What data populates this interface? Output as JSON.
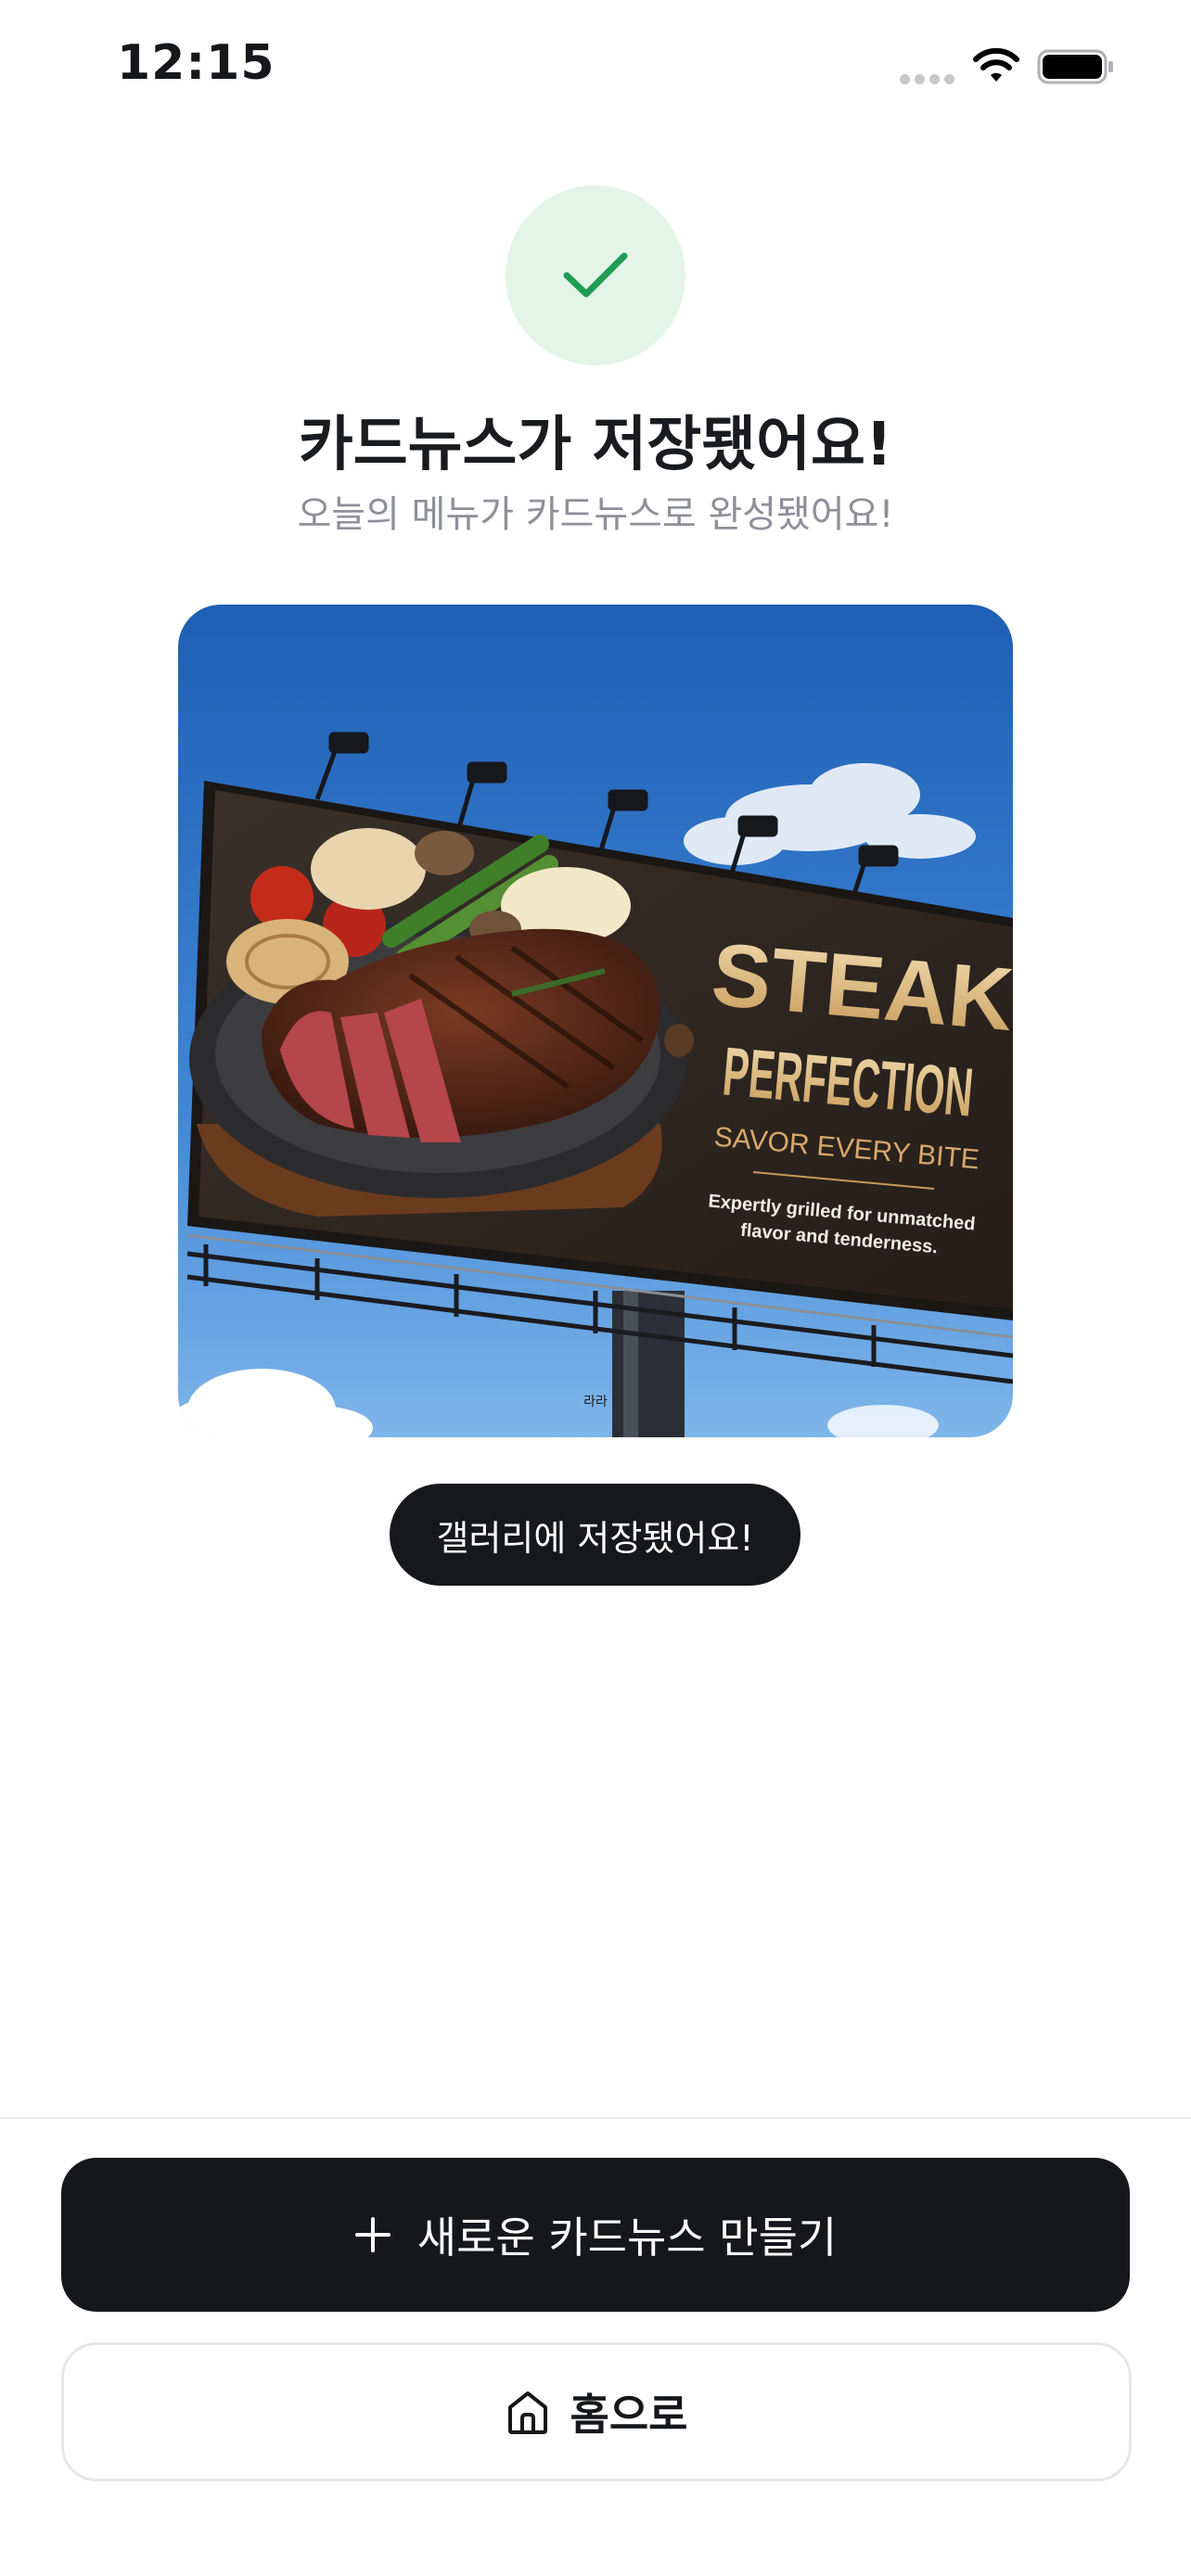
{
  "status_bar": {
    "time": "12:15"
  },
  "header": {
    "title": "카드뉴스가 저장됐어요!",
    "subtitle": "오늘의 메뉴가 카드뉴스로 완성됐어요!"
  },
  "card": {
    "headline_1": "STEAK",
    "headline_2": "PERFECTION",
    "tagline": "SAVOR EVERY BITE",
    "description_1": "Expertly grilled for unmatched",
    "description_2": "flavor and tenderness.",
    "small_caption": "라라"
  },
  "toast": {
    "text": "갤러리에 저장됐어요!"
  },
  "actions": {
    "create_new_label": "새로운 카드뉴스 만들기",
    "home_label": "홈으로"
  },
  "colors": {
    "success_bg": "#e3f4e8",
    "success_check": "#1f9d55",
    "primary_button": "#16171b",
    "subtitle_text": "#8d9098"
  },
  "icons": [
    "wifi-icon",
    "battery-icon",
    "check-icon",
    "plus-icon",
    "home-icon"
  ]
}
